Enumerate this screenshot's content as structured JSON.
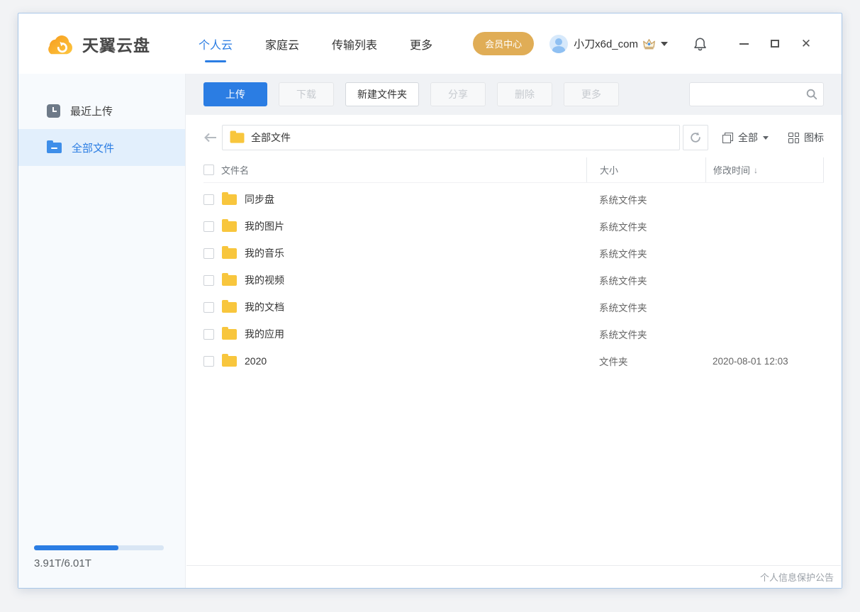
{
  "header": {
    "app_name": "天翼云盘",
    "tabs": [
      {
        "label": "个人云",
        "active": true
      },
      {
        "label": "家庭云",
        "active": false
      },
      {
        "label": "传输列表",
        "active": false
      },
      {
        "label": "更多",
        "active": false
      }
    ],
    "member_button": "会员中心",
    "username": "小刀x6d_com"
  },
  "sidebar": {
    "items": [
      {
        "label": "最近上传",
        "icon": "clock-icon",
        "active": false
      },
      {
        "label": "全部文件",
        "icon": "blue-folder-icon",
        "active": true
      }
    ],
    "storage": {
      "used": "3.91T",
      "total": "6.01T",
      "label": "3.91T/6.01T",
      "percent": 65
    }
  },
  "toolbar": {
    "buttons": [
      {
        "label": "上传",
        "state": "primary"
      },
      {
        "label": "下载",
        "state": "disabled"
      },
      {
        "label": "新建文件夹",
        "state": "normal"
      },
      {
        "label": "分享",
        "state": "disabled"
      },
      {
        "label": "删除",
        "state": "disabled"
      },
      {
        "label": "更多",
        "state": "disabled"
      }
    ],
    "search": {
      "value": "",
      "placeholder": ""
    }
  },
  "pathbar": {
    "location": "全部文件",
    "filter_label": "全部",
    "view_label": "图标"
  },
  "table": {
    "columns": {
      "name": "文件名",
      "size": "大小",
      "time": "修改时间"
    },
    "sort": {
      "column": "time",
      "direction": "desc",
      "glyph": "↓"
    },
    "rows": [
      {
        "name": "同步盘",
        "size": "系统文件夹",
        "time": ""
      },
      {
        "name": "我的图片",
        "size": "系统文件夹",
        "time": ""
      },
      {
        "name": "我的音乐",
        "size": "系统文件夹",
        "time": ""
      },
      {
        "name": "我的视频",
        "size": "系统文件夹",
        "time": ""
      },
      {
        "name": "我的文档",
        "size": "系统文件夹",
        "time": ""
      },
      {
        "name": "我的应用",
        "size": "系统文件夹",
        "time": ""
      },
      {
        "name": "2020",
        "size": "文件夹",
        "time": "2020-08-01 12:03"
      }
    ]
  },
  "footer": {
    "notice": "个人信息保护公告"
  },
  "colors": {
    "primary": "#2B7DE3",
    "gold": "#E0AD56",
    "folder_yellow": "#F8C63D",
    "sidebar_active_bg": "#E2EFFC"
  }
}
